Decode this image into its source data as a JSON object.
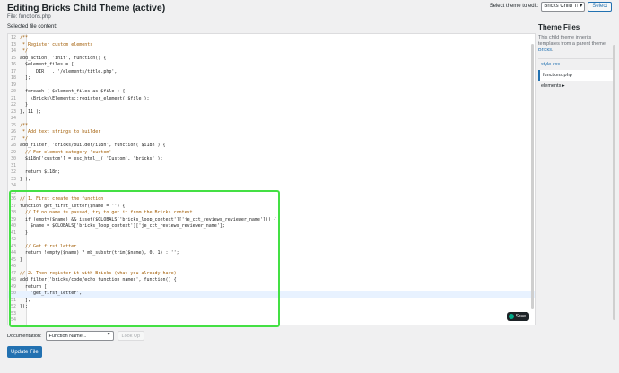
{
  "header": {
    "title": "Editing Bricks Child Theme (active)",
    "file_label": "File: functions.php",
    "selected_label": "Selected file content:"
  },
  "theme_select": {
    "label": "Select theme to edit:",
    "value": "Bricks Child Theme",
    "button": "Select"
  },
  "editor": {
    "lines": [
      {
        "n": "12",
        "t": "/**"
      },
      {
        "n": "13",
        "t": " * Register custom elements"
      },
      {
        "n": "14",
        "t": " */"
      },
      {
        "n": "15",
        "t": "add_action( 'init', function() {"
      },
      {
        "n": "16",
        "t": "  $element_files = ["
      },
      {
        "n": "17",
        "t": "    __DIR__ . '/elements/title.php',"
      },
      {
        "n": "18",
        "t": "  ];"
      },
      {
        "n": "19",
        "t": ""
      },
      {
        "n": "20",
        "t": "  foreach ( $element_files as $file ) {"
      },
      {
        "n": "21",
        "t": "    \\Bricks\\Elements::register_element( $file );"
      },
      {
        "n": "22",
        "t": "  }"
      },
      {
        "n": "23",
        "t": "}, 11 );"
      },
      {
        "n": "24",
        "t": ""
      },
      {
        "n": "25",
        "t": "/**"
      },
      {
        "n": "26",
        "t": " * Add text strings to builder"
      },
      {
        "n": "27",
        "t": " */"
      },
      {
        "n": "28",
        "t": "add_filter( 'bricks/builder/i18n', function( $i18n ) {"
      },
      {
        "n": "29",
        "t": "  // For element category 'custom'"
      },
      {
        "n": "30",
        "t": "  $i18n['custom'] = esc_html__( 'Custom', 'bricks' );"
      },
      {
        "n": "31",
        "t": ""
      },
      {
        "n": "32",
        "t": "  return $i18n;"
      },
      {
        "n": "33",
        "t": "} );"
      },
      {
        "n": "34",
        "t": ""
      },
      {
        "n": "35",
        "t": ""
      },
      {
        "n": "36",
        "t": "// 1. First create the function"
      },
      {
        "n": "37",
        "t": "function get_first_letter($name = '') {"
      },
      {
        "n": "38",
        "t": "  // If no name is passed, try to get it from the Bricks context"
      },
      {
        "n": "39",
        "t": "  if (empty($name) && isset($GLOBALS['bricks_loop_context']['je_cct_reviews_reviewer_name'])) {"
      },
      {
        "n": "40",
        "t": "    $name = $GLOBALS['bricks_loop_context']['je_cct_reviews_reviewer_name'];"
      },
      {
        "n": "41",
        "t": "  }"
      },
      {
        "n": "42",
        "t": ""
      },
      {
        "n": "43",
        "t": "  // Get first letter"
      },
      {
        "n": "44",
        "t": "  return !empty($name) ? mb_substr(trim($name), 0, 1) : '';"
      },
      {
        "n": "45",
        "t": "}"
      },
      {
        "n": "46",
        "t": ""
      },
      {
        "n": "47",
        "t": "// 2. Then register it with Bricks (what you already have)"
      },
      {
        "n": "48",
        "t": "add_filter('bricks/code/echo_function_names', function() {"
      },
      {
        "n": "49",
        "t": "  return ["
      },
      {
        "n": "50",
        "t": "    'get_first_letter',"
      },
      {
        "n": "51",
        "t": "  ];"
      },
      {
        "n": "52",
        "t": "});"
      },
      {
        "n": "53",
        "t": ""
      },
      {
        "n": "54",
        "t": ""
      }
    ],
    "active_line": "50",
    "save_label": "Save"
  },
  "documentation": {
    "label": "Documentation:",
    "select_value": "Function Name...",
    "lookup_button": "Look Up"
  },
  "update_button": "Update File",
  "sidebar": {
    "title": "Theme Files",
    "desc_prefix": "This child theme inherits templates from a parent theme,",
    "desc_link": "Bricks",
    "desc_suffix": ".",
    "files": [
      {
        "label": "style.css",
        "current": false,
        "folder": false
      },
      {
        "label": "functions.php",
        "current": true,
        "folder": false
      },
      {
        "label": "elements ▸",
        "current": false,
        "folder": true
      }
    ]
  },
  "colors": {
    "accent": "#2271b1",
    "highlight_box": "#44e044"
  }
}
